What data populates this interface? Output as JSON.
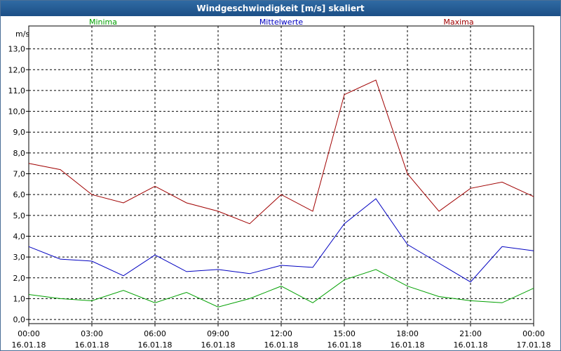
{
  "window": {
    "title": "Windgeschwindigkeit [m/s] skaliert"
  },
  "chart_data": {
    "type": "line",
    "title": "Windgeschwindigkeit [m/s] skaliert",
    "ylabel": "m/s",
    "ylim": [
      -0.2,
      14.1
    ],
    "grid": true,
    "legend": "top, spread across plot",
    "y_ticks": [
      "0,0",
      "1,0",
      "2,0",
      "3,0",
      "4,0",
      "5,0",
      "6,0",
      "7,0",
      "8,0",
      "9,0",
      "10,0",
      "11,0",
      "12,0",
      "13,0"
    ],
    "x_ticks": [
      {
        "time": "00:00",
        "date": "16.01.18"
      },
      {
        "time": "03:00",
        "date": "16.01.18"
      },
      {
        "time": "06:00",
        "date": "16.01.18"
      },
      {
        "time": "09:00",
        "date": "16.01.18"
      },
      {
        "time": "12:00",
        "date": "16.01.18"
      },
      {
        "time": "15:00",
        "date": "16.01.18"
      },
      {
        "time": "18:00",
        "date": "16.01.18"
      },
      {
        "time": "21:00",
        "date": "16.01.18"
      },
      {
        "time": "00:00",
        "date": "17.01.18"
      }
    ],
    "x_hours": [
      0.0,
      1.5,
      3.0,
      4.5,
      6.0,
      7.5,
      9.0,
      10.5,
      12.0,
      13.5,
      15.0,
      16.5,
      18.0,
      19.5,
      21.0,
      22.5,
      24.0
    ],
    "series": [
      {
        "name": "Minima",
        "color": "#00a000",
        "values": [
          1.2,
          1.0,
          0.9,
          1.4,
          0.8,
          1.3,
          0.6,
          1.0,
          1.6,
          0.8,
          1.9,
          2.4,
          1.6,
          1.1,
          0.9,
          0.8,
          1.5
        ]
      },
      {
        "name": "Mittelwerte",
        "color": "#0000c0",
        "values": [
          3.5,
          2.9,
          2.8,
          2.1,
          3.1,
          2.3,
          2.4,
          2.2,
          2.6,
          2.5,
          4.6,
          5.8,
          3.6,
          2.7,
          1.8,
          3.5,
          3.3
        ]
      },
      {
        "name": "Maxima",
        "color": "#a00000",
        "values": [
          7.5,
          7.2,
          6.0,
          5.6,
          6.4,
          5.6,
          5.2,
          4.6,
          6.0,
          5.2,
          10.8,
          11.5,
          7.0,
          5.2,
          6.3,
          6.6,
          5.9
        ]
      }
    ]
  }
}
